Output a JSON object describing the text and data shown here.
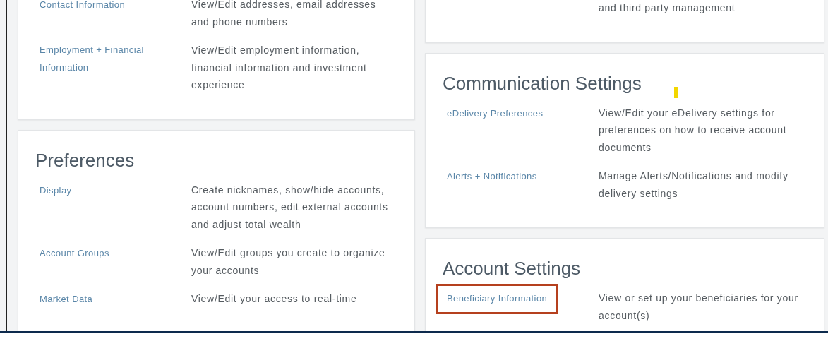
{
  "columns": [
    {
      "cards": [
        {
          "rows": [
            {
              "label": "Contact Information",
              "description": "View/Edit addresses, email addresses and phone numbers",
              "highlighted": false
            },
            {
              "label": "Employment + Financial Information",
              "description": "View/Edit employment information, financial information and investment experience",
              "highlighted": false
            }
          ]
        },
        {
          "title": "Preferences",
          "rows": [
            {
              "label": "Display",
              "description": "Create nicknames, show/hide accounts, account numbers, edit external accounts and adjust total wealth",
              "highlighted": false
            },
            {
              "label": "Account Groups",
              "description": "View/Edit groups you create to organize your accounts",
              "highlighted": false
            },
            {
              "label": "Market Data",
              "description": "View/Edit your access to real-time",
              "highlighted": false
            }
          ]
        }
      ]
    },
    {
      "cards": [
        {
          "rows": [
            {
              "description": "and third party management",
              "highlighted": false
            }
          ]
        },
        {
          "title": "Communication Settings",
          "rows": [
            {
              "label": "eDelivery Preferences",
              "description": "View/Edit your eDelivery settings for preferences on how to receive account documents",
              "highlighted": false
            },
            {
              "label": "Alerts + Notifications",
              "description": "Manage Alerts/Notifications and modify delivery settings",
              "highlighted": false
            }
          ]
        },
        {
          "title": "Account Settings",
          "rows": [
            {
              "label": "Beneficiary Information",
              "description": "View or set up your beneficiaries for your account(s)",
              "highlighted": true
            }
          ]
        }
      ]
    }
  ]
}
